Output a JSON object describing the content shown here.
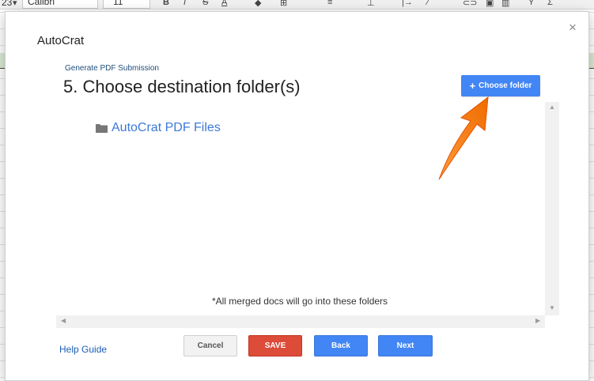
{
  "background": {
    "toolbar": {
      "zoom": "23",
      "font": "Calibri",
      "font_size": "11"
    }
  },
  "dialog": {
    "title": "AutoCrat",
    "close_symbol": "×"
  },
  "content": {
    "breadcrumb": "Generate PDF Submission",
    "step_title": "5. Choose destination folder(s)",
    "choose_button_label": "Choose folder",
    "folders": [
      {
        "label": "AutoCrat PDF Files",
        "icon": "folder-icon"
      }
    ],
    "note": "*All merged docs will go into these folders"
  },
  "footer": {
    "help_label": "Help Guide",
    "cancel_label": "Cancel",
    "save_label": "SAVE",
    "back_label": "Back",
    "next_label": "Next"
  },
  "colors": {
    "primary_blue": "#4285f4",
    "save_red": "#dd4b39",
    "annotation_arrow": "#f57c00",
    "link_blue": "#3c78d8"
  }
}
